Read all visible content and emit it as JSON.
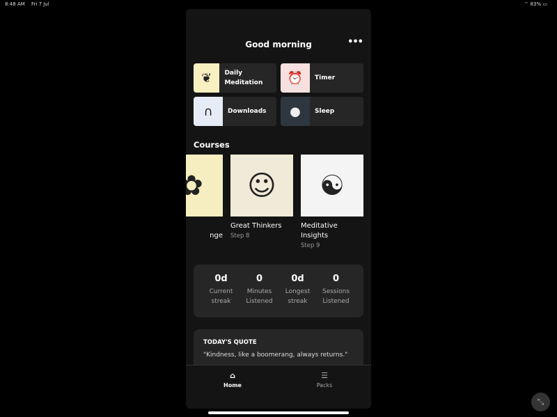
{
  "status": {
    "time": "8:48 AM",
    "date": "Fri 7 Jul",
    "battery": "83%"
  },
  "header": {
    "title": "Good morning",
    "more_icon": "ellipsis-icon"
  },
  "tiles": [
    {
      "label": "Daily Meditation",
      "bg": "#f8f0c0",
      "icon": "plant-heart-icon",
      "glyph": "❦"
    },
    {
      "label": "Timer",
      "bg": "#f6e0e0",
      "icon": "alarm-clock-icon",
      "glyph": "⏰"
    },
    {
      "label": "Downloads",
      "bg": "#e6ecf6",
      "icon": "magnet-icon",
      "glyph": "∩"
    },
    {
      "label": "Sleep",
      "bg": "#2e3640",
      "icon": "moon-rocket-icon",
      "glyph": "●"
    }
  ],
  "courses": {
    "title": "Courses",
    "items": [
      {
        "name": "nge",
        "step": "",
        "bg": "#f6eec0",
        "glyph": "✿"
      },
      {
        "name": "Great Thinkers",
        "step": "Step 8",
        "bg": "#f0ead8",
        "glyph": "☺"
      },
      {
        "name": "Meditative Insights",
        "step": "Step 9",
        "bg": "#f4f4f4",
        "glyph": "☯"
      }
    ]
  },
  "stats": [
    {
      "value": "0d",
      "label": "Current streak"
    },
    {
      "value": "0",
      "label": "Minutes Listened"
    },
    {
      "value": "0d",
      "label": "Longest streak"
    },
    {
      "value": "0",
      "label": "Sessions Listened"
    }
  ],
  "quote": {
    "heading": "TODAY'S QUOTE",
    "text": "\"Kindness, like a boomerang, always returns.\""
  },
  "nav": [
    {
      "label": "Home",
      "icon": "home-icon",
      "active": true
    },
    {
      "label": "Packs",
      "icon": "list-icon",
      "active": false
    }
  ]
}
